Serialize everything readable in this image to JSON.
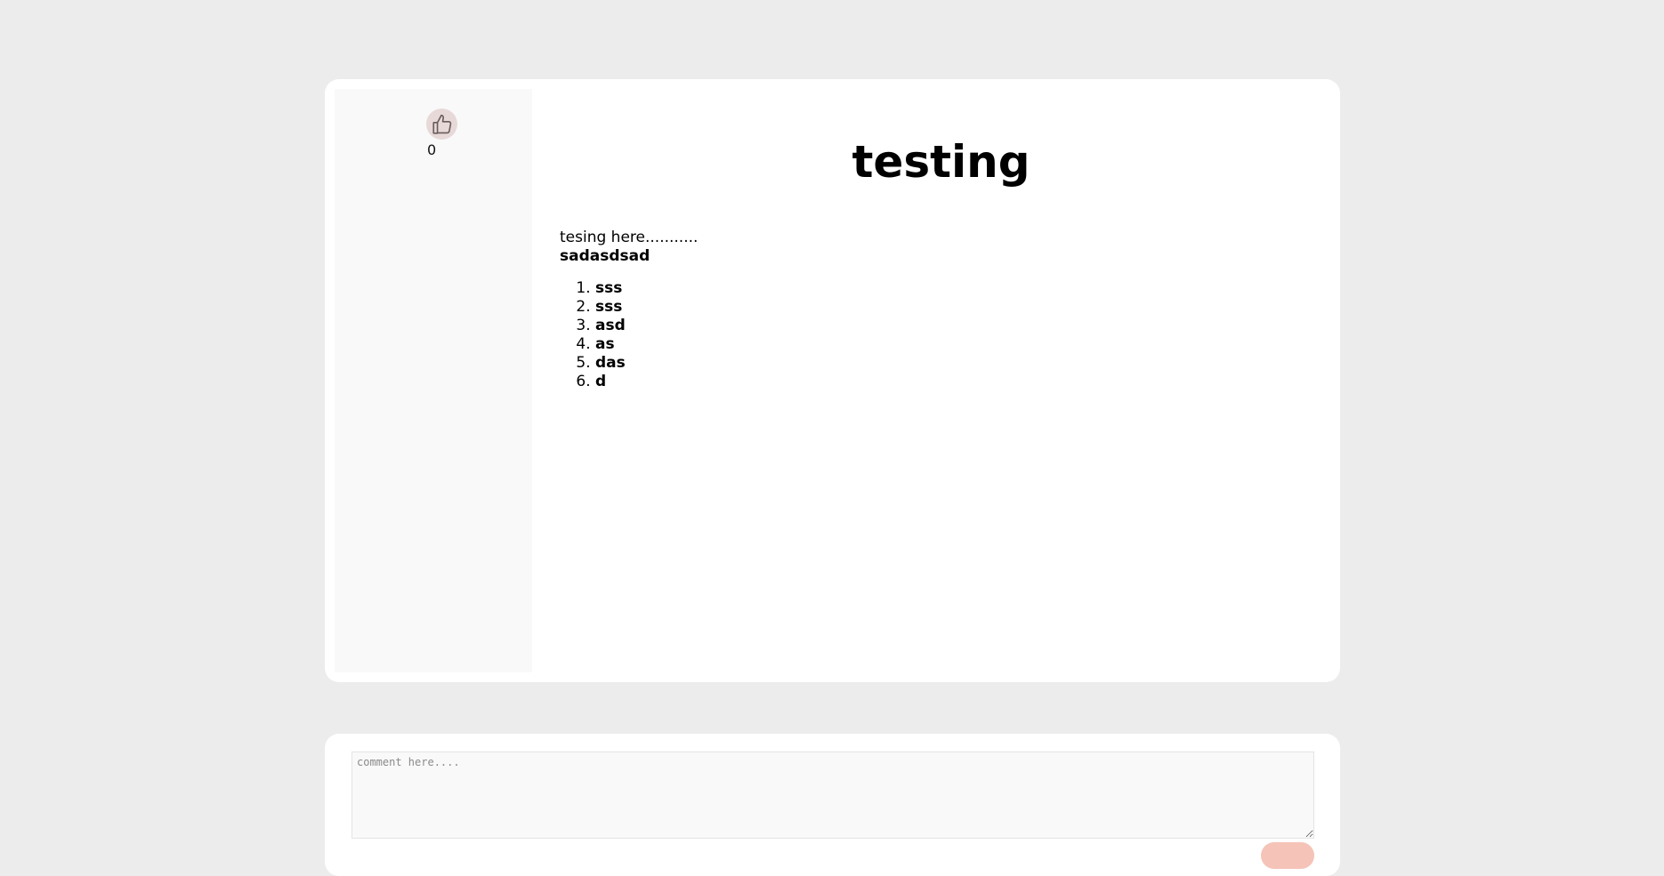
{
  "post": {
    "title": "testing",
    "likes": "0",
    "body_line": "tesing here...........",
    "body_bold": "sadasdsad",
    "list_items": [
      "sss",
      "sss",
      "asd",
      "as",
      "das",
      "d"
    ]
  },
  "comment": {
    "placeholder": "comment here...."
  },
  "icons": {
    "like": "thumbs-up-icon"
  },
  "colors": {
    "page_background": "#ececec",
    "side_panel": "#f9f9f9",
    "like_button_bg": "#e8d9d9",
    "submit_button_bg": "#f5c3b8"
  }
}
